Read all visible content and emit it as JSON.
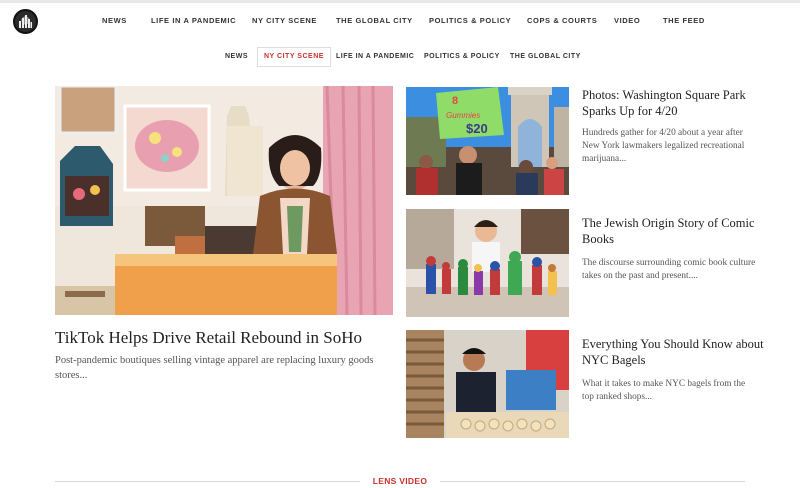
{
  "top_nav": [
    "NEWS",
    "LIFE IN A PANDEMIC",
    "NY CITY SCENE",
    "THE GLOBAL CITY",
    "POLITICS & POLICY",
    "COPS & COURTS",
    "VIDEO",
    "THE FEED"
  ],
  "sub_nav": [
    "NEWS",
    "NY CITY SCENE",
    "LIFE IN A PANDEMIC",
    "POLITICS & POLICY",
    "THE GLOBAL CITY"
  ],
  "sub_nav_active": "NY CITY SCENE",
  "lead": {
    "title": "TikTok Helps Drive Retail Rebound in SoHo",
    "description": "Post-pandemic boutiques selling vintage apparel are replacing luxury goods stores..."
  },
  "side_stories": [
    {
      "title": "Photos: Washington Square Park Sparks Up for 4/20",
      "description": "Hundreds gather for 4/20 about a year after New York lawmakers legalized recreational marijuana..."
    },
    {
      "title": "The Jewish Origin Story of Comic Books",
      "description": "The discourse surrounding comic book culture takes on the past and present...."
    },
    {
      "title": "Everything You Should Know about NYC Bagels",
      "description": "What it takes to make NYC bagels from the top ranked shops..."
    }
  ],
  "sign_text": [
    "8",
    "Gummies",
    "$20"
  ],
  "section_label": "LENS VIDEO",
  "colors": {
    "accent": "#c8322b",
    "text": "#222222",
    "muted": "#555555"
  }
}
